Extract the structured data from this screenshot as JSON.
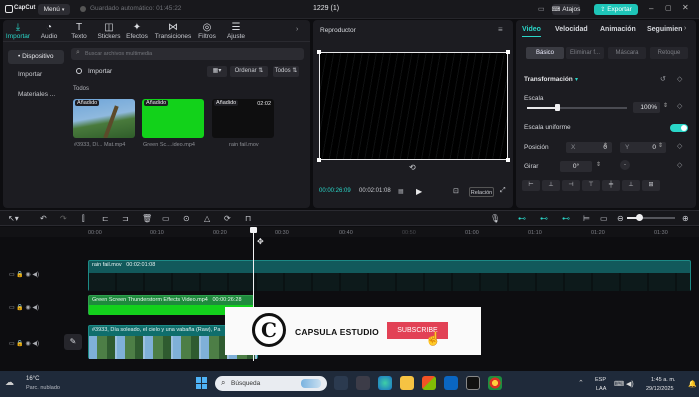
{
  "titlebar": {
    "app_name": "CapCut",
    "menu_label": "Menú",
    "autosave": "Guardado automático: 01:45:22",
    "project_title": "1229 (1)",
    "shortcuts": "Atajos",
    "export": "Exportar"
  },
  "media_tabs": [
    {
      "label": "Importar",
      "icon": "import-icon"
    },
    {
      "label": "Audio",
      "icon": "audio-icon"
    },
    {
      "label": "Texto",
      "icon": "text-icon"
    },
    {
      "label": "Stickers",
      "icon": "sticker-icon"
    },
    {
      "label": "Efectos",
      "icon": "effects-icon"
    },
    {
      "label": "Transiciones",
      "icon": "transition-icon"
    },
    {
      "label": "Filtros",
      "icon": "filter-icon"
    },
    {
      "label": "Ajuste",
      "icon": "adjust-icon"
    }
  ],
  "sidebar": {
    "items": [
      "• Dispositivo",
      "Importar",
      "Materiales ..."
    ]
  },
  "media": {
    "search_placeholder": "Buscar archivos multimedia",
    "import_label": "Importar",
    "sort_label": "Ordenar",
    "filter_label": "Todos",
    "section_label": "Todos",
    "items": [
      {
        "tag": "Añadido",
        "duration": "",
        "caption": "#3933, Dí... Mat.mp4"
      },
      {
        "tag": "Añadido",
        "duration": "",
        "caption": "Green Sc....ideo.mp4"
      },
      {
        "tag": "Añadido",
        "duration": "02:02",
        "caption": "rain fail.mov"
      }
    ]
  },
  "player": {
    "title": "Reproductor",
    "current_time": "00:00:26:09",
    "total_time": "00:02:01:08",
    "ratio_label": "Relación"
  },
  "inspector": {
    "tabs": [
      "Video",
      "Velocidad",
      "Animación",
      "Seguimien"
    ],
    "subtabs": [
      "Básico",
      "Eliminar f...",
      "Máscara",
      "Retoque"
    ],
    "section": "Transformación",
    "scale_label": "Escala",
    "scale_value": "100%",
    "uniform_label": "Escala uniforme",
    "position_label": "Posición",
    "pos_x_label": "X",
    "pos_x": "0",
    "pos_y_label": "Y",
    "pos_y": "0",
    "rotate_label": "Girar",
    "rotate_value": "0°",
    "scale_fraction": 0.3
  },
  "timeline": {
    "ruler": [
      "00:00",
      "00:10",
      "00:20",
      "00:30",
      "00:40",
      "01:00",
      "01:10",
      "01:20",
      "01:30",
      "01:40"
    ],
    "clips": {
      "rain": "rain fail.mov   00:02:01:08",
      "green": "Green Screen Thunderstorm Effects Video.mp4   00:00:26:28",
      "main": "#3933, Día soleado, el cielo y una vabaña (Raw), Pa"
    }
  },
  "overlay": {
    "channel": "CAPSULA ESTUDIO",
    "subscribe": "SUBSCRIBE"
  },
  "taskbar": {
    "temp": "16°C",
    "weather": "Parc. nublado",
    "search": "Búsqueda",
    "lang_top": "ESP",
    "lang_bottom": "LAA",
    "time": "1:45 a. m.",
    "date": "29/12/2025"
  },
  "colors": {
    "accent": "#2ad6c8",
    "export_bg": "#1ec5b8",
    "subscribe_bg": "#e24155",
    "rain_clip": "#12595b",
    "green_clip": "#1f8a3d"
  }
}
